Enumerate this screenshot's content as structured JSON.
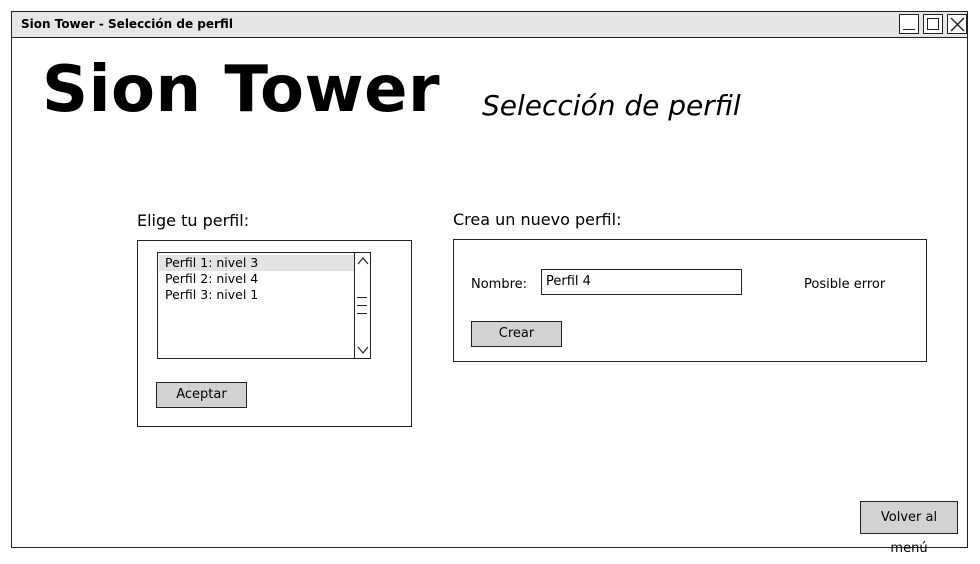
{
  "window": {
    "title": "Sion Tower - Selección de perfil"
  },
  "header": {
    "app_title": "Sion Tower",
    "subtitle": "Selección de perfil"
  },
  "select_profile": {
    "label": "Elige tu perfil:",
    "items": [
      {
        "label": "Perfil 1: nivel 3",
        "selected": true
      },
      {
        "label": "Perfil 2: nivel 4",
        "selected": false
      },
      {
        "label": "Perfil 3: nivel 1",
        "selected": false
      }
    ],
    "accept_label": "Aceptar"
  },
  "new_profile": {
    "label": "Crea un nuevo perfil:",
    "name_label": "Nombre:",
    "name_value": "Perfil 4",
    "error_text": "Posible error",
    "create_label": "Crear"
  },
  "footer": {
    "back_label": "Volver al menú"
  }
}
